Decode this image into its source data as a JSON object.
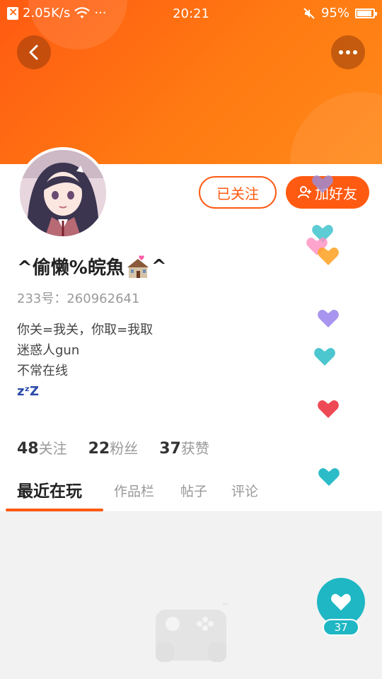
{
  "status_bar": {
    "speed": "2.05K/s",
    "dots": "···",
    "time": "20:21",
    "battery": "95%"
  },
  "header": {
    "back_icon": "chevron-left-icon",
    "more_icon": "more-horizontal-icon",
    "gradient_colors": [
      "#ff5a12",
      "#ff8a1a"
    ]
  },
  "profile": {
    "username_prefix": "^偷懒%皖魚",
    "username_suffix": "^",
    "user_id": "233号：260962641",
    "bio_lines": [
      "你关=我关，你取=我取",
      "迷惑人gun",
      "不常在线"
    ],
    "bio_zzz": "zᶻZ",
    "follow_button": "已关注",
    "add_friend_button": "加好友"
  },
  "stats": [
    {
      "value": "48",
      "label": "关注"
    },
    {
      "value": "22",
      "label": "粉丝"
    },
    {
      "value": "37",
      "label": "获赞"
    }
  ],
  "tabs": [
    "最近在玩",
    "作品栏",
    "帖子",
    "评论"
  ],
  "like": {
    "count": "37",
    "color": "#1fb7c4"
  },
  "colors": {
    "accent": "#ff5a12",
    "teal": "#1fb7c4"
  }
}
